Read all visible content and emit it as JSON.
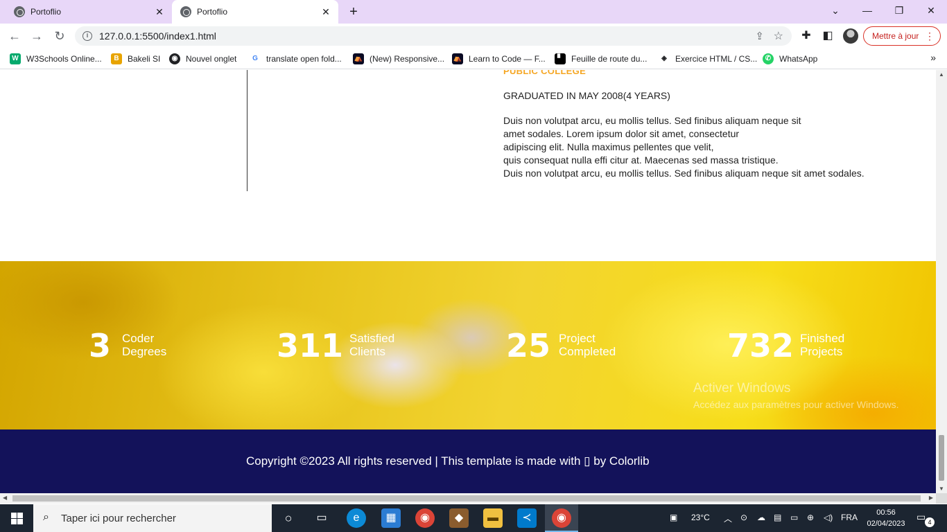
{
  "browser": {
    "tabs": [
      {
        "label": "Portoflio",
        "close": "✕"
      },
      {
        "label": "Portoflio",
        "close": "✕"
      }
    ],
    "new_tab": "+",
    "window_controls": {
      "dropdown": "⌄",
      "minimize": "—",
      "restore": "❐",
      "close": "✕"
    },
    "url": "127.0.0.1:5500/index1.html",
    "update_button": "Mettre à jour",
    "bookmarks": [
      {
        "label": "W3Schools Online...",
        "icon": "w3schools-icon",
        "glyph": "W",
        "color": "#04aa6d"
      },
      {
        "label": "Bakeli SI",
        "icon": "bakeli-icon",
        "glyph": "B",
        "color": "#e8a400"
      },
      {
        "label": "Nouvel onglet",
        "icon": "globe-icon",
        "glyph": "◉",
        "color": "#202124"
      },
      {
        "label": "translate open fold...",
        "icon": "google-icon",
        "glyph": "G",
        "color": "#4285f4"
      },
      {
        "label": "(New) Responsive...",
        "icon": "freecodecamp-icon",
        "glyph": "⛺",
        "color": "#0a0a23"
      },
      {
        "label": "Learn to Code — F...",
        "icon": "freecodecamp-icon",
        "glyph": "⛺",
        "color": "#0a0a23"
      },
      {
        "label": "Feuille de route du...",
        "icon": "roadmap-icon",
        "glyph": "▘",
        "color": "#000000"
      },
      {
        "label": "Exercice HTML / CS...",
        "icon": "codepen-icon",
        "glyph": "◈",
        "color": "#202124"
      },
      {
        "label": "WhatsApp",
        "icon": "whatsapp-icon",
        "glyph": "✆",
        "color": "#25d366"
      }
    ],
    "bookmarks_more": "»"
  },
  "education": {
    "school": "PUBLIC COLLEGE",
    "date": "GRADUATED IN MAY 2008(4 YEARS)",
    "description": "Duis non volutpat arcu, eu mollis tellus. Sed finibus aliquam neque sit\namet sodales. Lorem ipsum dolor sit amet, consectetur\nadipiscing elit. Nulla maximus pellentes que velit,\nquis consequat nulla effi citur at. Maecenas sed massa tristique.\nDuis non volutpat arcu, eu mollis tellus. Sed finibus aliquam neque sit amet sodales."
  },
  "counters": [
    {
      "number": "3",
      "label": "Coder\nDegrees"
    },
    {
      "number": "311",
      "label": "Satisfied\nClients"
    },
    {
      "number": "25",
      "label": "Project\nCompleted"
    },
    {
      "number": "732",
      "label": "Finished\nProjects"
    }
  ],
  "footer": {
    "copyright": "Copyright ©2023 All rights reserved | This template is made with ▯ by Colorlib"
  },
  "watermark": {
    "title": "Activer Windows",
    "subtitle": "Accédez aux paramètres pour activer Windows."
  },
  "taskbar": {
    "search_placeholder": "Taper ici pour rechercher",
    "weather": "23°C",
    "language": "FRA",
    "time": "00:56",
    "date": "02/04/2023",
    "notifications": "4"
  },
  "colors": {
    "accent_orange": "#f5a623",
    "footer_bg": "#13125a",
    "counter_bg": "#f2d430"
  }
}
